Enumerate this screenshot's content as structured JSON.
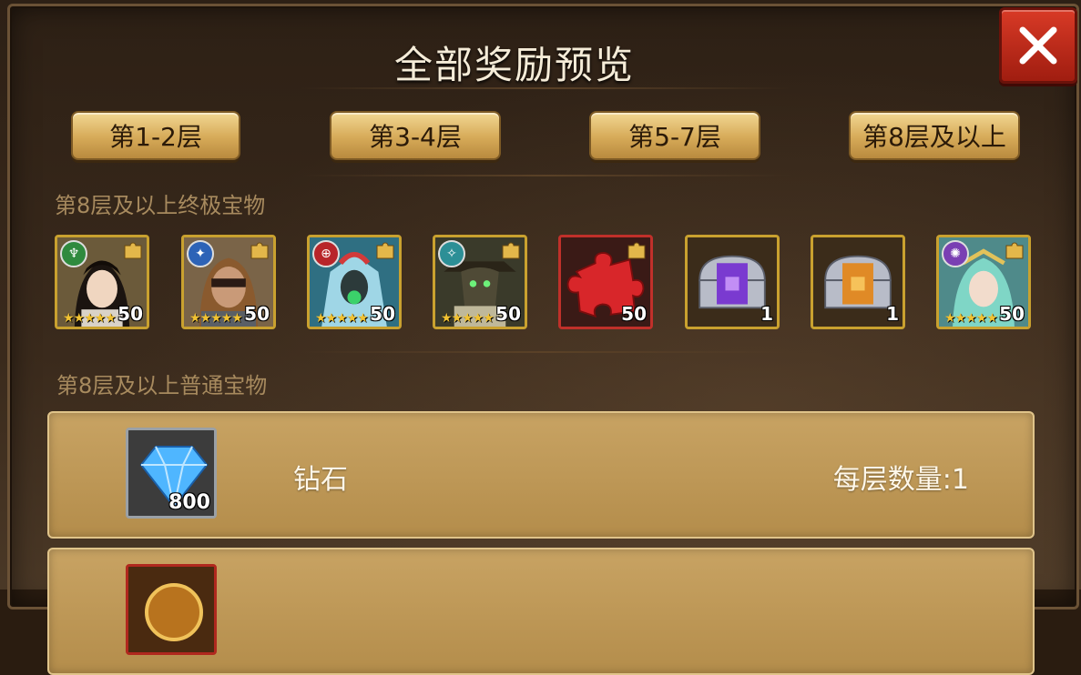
{
  "title": "全部奖励预览",
  "tabs": [
    {
      "label": "第1-2层"
    },
    {
      "label": "第3-4层"
    },
    {
      "label": "第5-7层"
    },
    {
      "label": "第8层及以上"
    }
  ],
  "ultimate": {
    "label": "第8层及以上终极宝物",
    "items": [
      {
        "kind": "hero-shard",
        "icon": "hero-portrait-woman-icon",
        "faction": "forest",
        "stars": "★★★★★",
        "count": "50"
      },
      {
        "kind": "hero-shard",
        "icon": "hero-portrait-masked-man-icon",
        "faction": "fortress",
        "stars": "★★★★★",
        "count": "50"
      },
      {
        "kind": "hero-shard",
        "icon": "hero-portrait-armored-icon",
        "faction": "abyss",
        "stars": "★★★★★",
        "count": "50"
      },
      {
        "kind": "hero-shard",
        "icon": "hero-portrait-hooded-icon",
        "faction": "shadow",
        "stars": "★★★★★",
        "count": "50"
      },
      {
        "kind": "puzzle",
        "icon": "red-puzzle-piece-icon",
        "count": "50"
      },
      {
        "kind": "chest",
        "icon": "purple-chest-icon",
        "count": "1"
      },
      {
        "kind": "chest",
        "icon": "orange-chest-icon",
        "count": "1"
      },
      {
        "kind": "hero-shard",
        "icon": "hero-portrait-elf-icon",
        "faction": "dark",
        "stars": "★★★★★",
        "count": "50"
      }
    ]
  },
  "normal": {
    "label": "第8层及以上普通宝物",
    "rows": [
      {
        "icon": "diamond-icon",
        "icon_count": "800",
        "name": "钻石",
        "qty": "每层数量:1"
      },
      {
        "icon": "medal-icon",
        "icon_count": "",
        "name": "",
        "qty": ""
      }
    ]
  },
  "colors": {
    "gold_border": "#c9a12f",
    "close_red": "#c0302a",
    "row_tan": "#bf9a58"
  }
}
